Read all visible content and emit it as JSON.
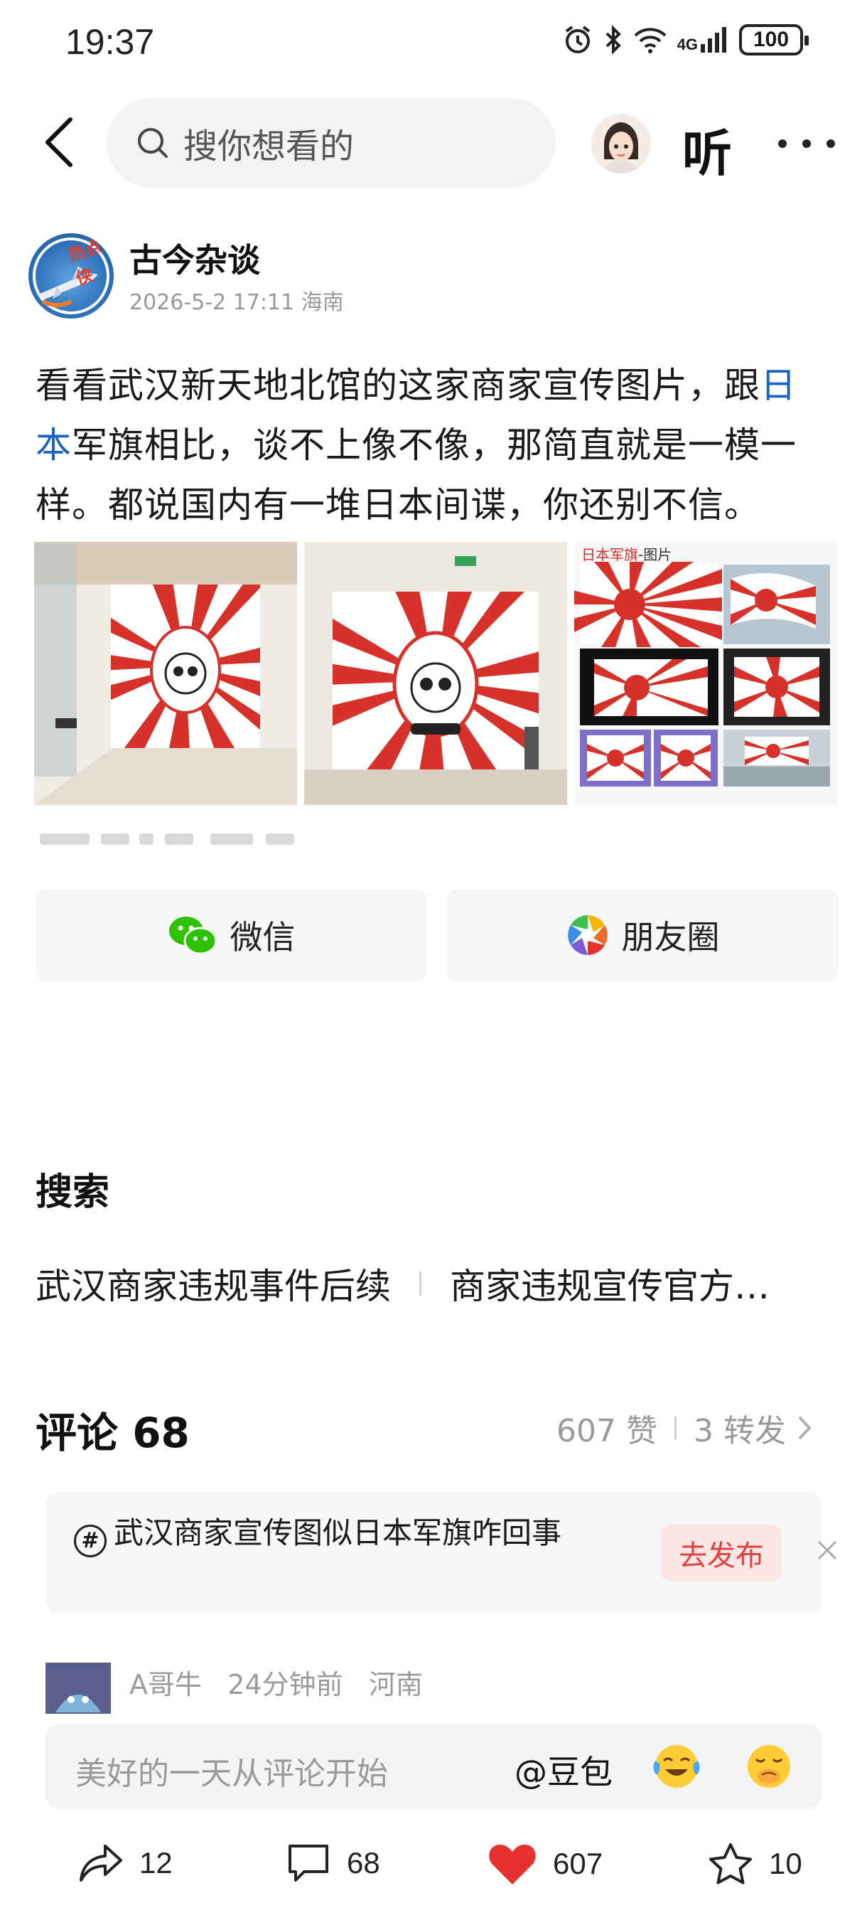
{
  "status_bar": {
    "time": "19:37",
    "network": "4G",
    "battery": "100"
  },
  "topbar": {
    "search_placeholder": "搜你想看的",
    "listen_label": "听"
  },
  "author": {
    "name": "古今杂谈",
    "badge": "热点侠",
    "date": "2026-5-2 17:11",
    "location": "海南"
  },
  "post": {
    "text_1": "看看武汉新天地北馆的这家商家宣传图片，跟",
    "link_text": "日本",
    "text_2": "军旗相比，谈不上像不像，那简直就是一模一样。都说国内有一堆日本间谍，你还别不信。",
    "image3_caption_1": "日本军旗",
    "image3_caption_2": "-图片"
  },
  "share": {
    "wechat_label": "微信",
    "moments_label": "朋友圈"
  },
  "search_section": {
    "title": "搜索",
    "tags": [
      "武汉商家违规事件后续",
      "商家违规宣传官方…"
    ]
  },
  "comments": {
    "title": "评论 68",
    "likes": "607 赞",
    "reposts": "3 转发",
    "topic_text": "武汉商家宣传图似日本军旗咋回事",
    "topic_button": "去发布",
    "preview_user": "A哥牛",
    "preview_time": "24分钟前",
    "preview_location": "河南"
  },
  "input": {
    "placeholder": "美好的一天从评论开始",
    "at_label": "@豆包"
  },
  "actions": {
    "share_count": "12",
    "comment_count": "68",
    "like_count": "607",
    "favorite_count": "10"
  },
  "colors": {
    "link": "#1b62c7",
    "like_red": "#e8312f",
    "topic_button_bg": "#fde7e6",
    "topic_button_text": "#e0413b",
    "wechat_green": "#2dc100"
  }
}
